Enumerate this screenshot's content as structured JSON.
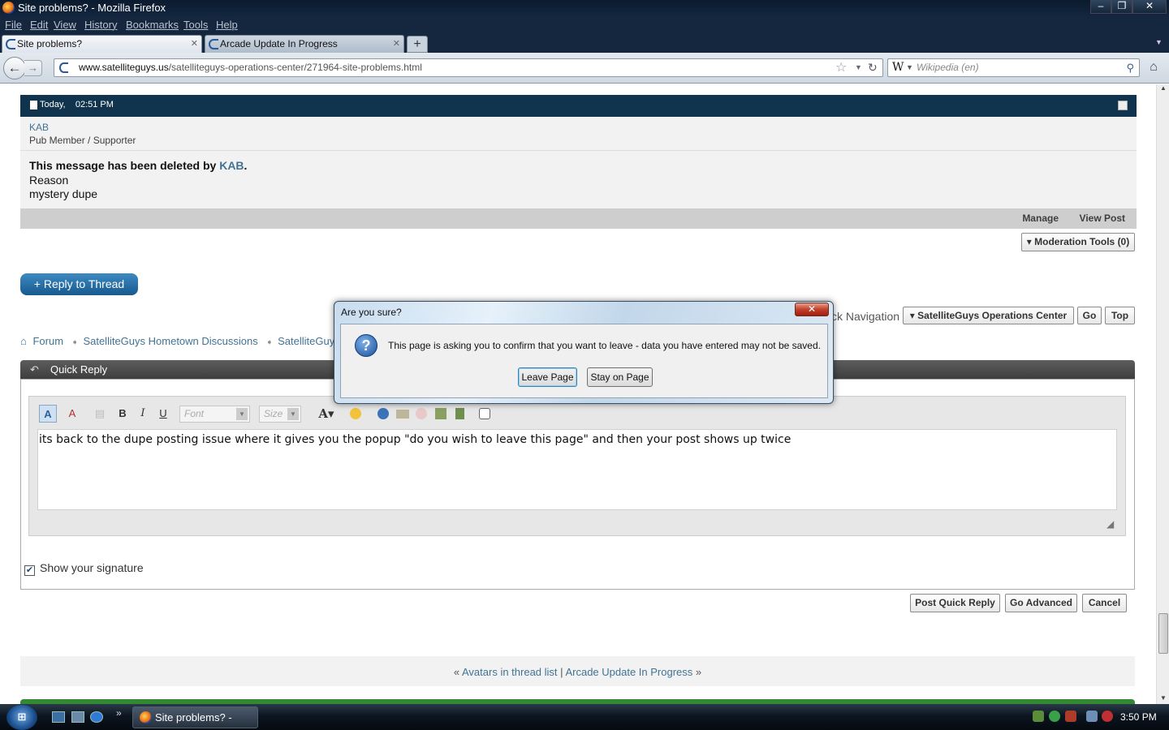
{
  "window": {
    "title": "Site problems? - Mozilla Firefox",
    "min": "–",
    "max": "❐",
    "close": "✕"
  },
  "menu": [
    "File",
    "Edit",
    "View",
    "History",
    "Bookmarks",
    "Tools",
    "Help"
  ],
  "tabs": [
    {
      "label": "Site problems?",
      "close": "✕"
    },
    {
      "label": "Arcade Update In Progress",
      "close": "✕"
    }
  ],
  "new_tab": "+",
  "nav": {
    "back": "←",
    "forward": "→",
    "url_host": "www.satelliteguys.us",
    "url_path": "/satelliteguys-operations-center/271964-site-problems.html",
    "search_engine": "W",
    "search_placeholder": "Wikipedia (en)"
  },
  "post": {
    "date": "Today,",
    "time": "02:51 PM",
    "user": "KAB",
    "rank": "Pub Member / Supporter",
    "deleted_prefix": "This message has been deleted by",
    "deleted_by": "KAB",
    "deleted_suffix": ".",
    "reason_label": "Reason",
    "reason": "mystery dupe",
    "manage": "Manage",
    "view_post": "View Post"
  },
  "moderation_tools": "▾ Moderation Tools (0)",
  "reply_to_thread": "+ Reply to Thread",
  "quick_navigation": {
    "label": "ck Navigation",
    "select": "▾ SatelliteGuys Operations Center",
    "go": "Go",
    "top": "Top"
  },
  "breadcrumb": [
    "Forum",
    "SatelliteGuys Hometown Discussions",
    "SatelliteGuys"
  ],
  "quick_reply": {
    "title": "Quick Reply",
    "toolbar": {
      "font_placeholder": "Font",
      "size_placeholder": "Size"
    },
    "text": "its back to the dupe posting issue where it gives you the popup \"do you wish to leave this page\" and then your post shows up twice",
    "show_signature": "Show your signature",
    "post_button": "Post Quick Reply",
    "advanced_button": "Go Advanced",
    "cancel_button": "Cancel"
  },
  "thread_nav": {
    "prev_mark": "«",
    "prev": "Avatars in thread list",
    "sep": "|",
    "next": "Arcade Update In Progress",
    "next_mark": "»"
  },
  "dialog": {
    "title": "Are you sure?",
    "close": "✕",
    "message": "This page is asking you to confirm that you want to leave - data you have entered may not be saved.",
    "leave": "Leave Page",
    "stay": "Stay on Page"
  },
  "taskbar": {
    "task": "Site problems? - Mo...",
    "clock": "3:50 PM"
  }
}
